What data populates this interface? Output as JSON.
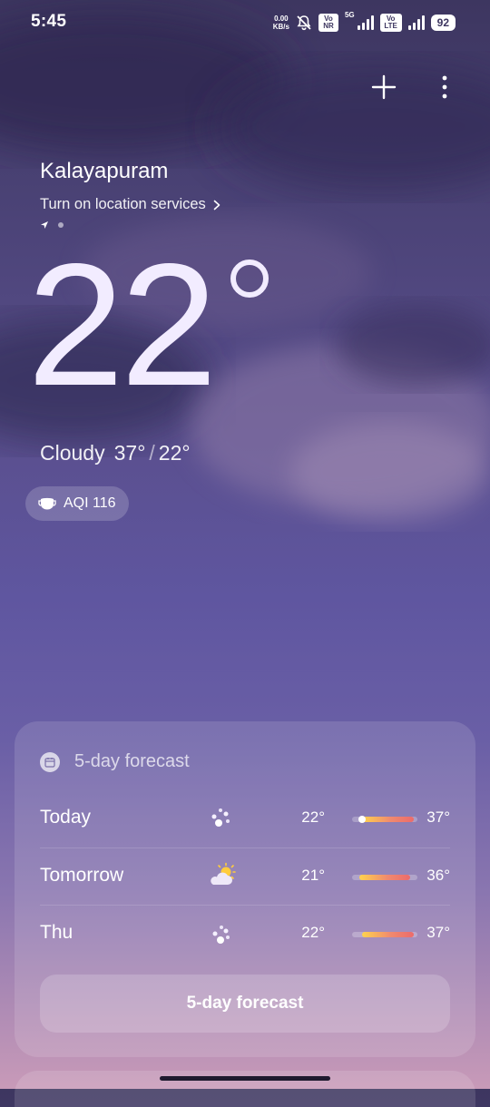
{
  "status_bar": {
    "time": "5:45",
    "net_speed_value": "0.00",
    "net_speed_unit": "KB/s",
    "volte1": "Vo NR",
    "fiveg": "5G",
    "volte2": "Vo LTE",
    "battery": "92"
  },
  "weather": {
    "location": "Kalayapuram",
    "location_services": "Turn on location services",
    "temperature": "22",
    "condition": "Cloudy",
    "high": "37°",
    "low": "22°",
    "aqi": "AQI 116"
  },
  "forecast": {
    "title": "5-day forecast",
    "button_label": "5-day forecast",
    "days": [
      {
        "day": "Today",
        "icon": "snow-icon",
        "low": "22°",
        "high": "37°",
        "low_value": 22,
        "high_value": 37,
        "current_value": 22
      },
      {
        "day": "Tomorrow",
        "icon": "partly-cloudy-icon",
        "low": "21°",
        "high": "36°",
        "low_value": 21,
        "high_value": 36
      },
      {
        "day": "Thu",
        "icon": "snow-icon",
        "low": "22°",
        "high": "37°",
        "low_value": 22,
        "high_value": 37
      }
    ]
  },
  "colors": {
    "background_top": "#3d3660",
    "background_bottom": "#c89ab8",
    "bar_warm": "#f08a6e",
    "bar_yellow": "#ffd34d"
  }
}
